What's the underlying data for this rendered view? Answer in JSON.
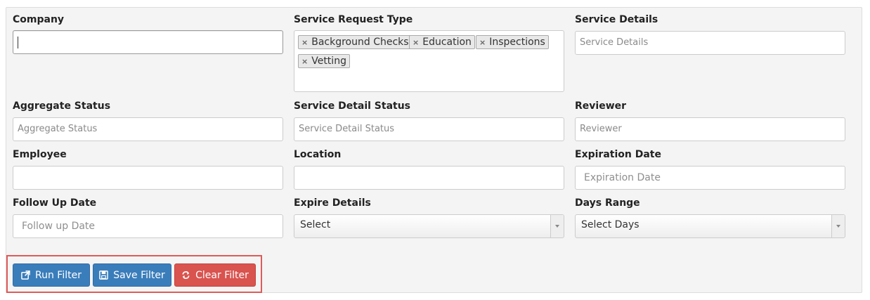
{
  "filters": {
    "company": {
      "label": "Company",
      "value": ""
    },
    "service_request_type": {
      "label": "Service Request Type",
      "tags": [
        "Background Checks",
        "Education",
        "Inspections",
        "Vetting"
      ],
      "remove_glyph": "×"
    },
    "service_details": {
      "label": "Service Details",
      "placeholder": "Service Details"
    },
    "aggregate_status": {
      "label": "Aggregate Status",
      "placeholder": "Aggregate Status"
    },
    "service_detail_status": {
      "label": "Service Detail Status",
      "placeholder": "Service Detail Status"
    },
    "reviewer": {
      "label": "Reviewer",
      "placeholder": "Reviewer"
    },
    "employee": {
      "label": "Employee",
      "value": ""
    },
    "location": {
      "label": "Location",
      "value": ""
    },
    "expiration_date": {
      "label": "Expiration Date",
      "placeholder": "Expiration Date"
    },
    "follow_up_date": {
      "label": "Follow Up Date",
      "placeholder": "Follow up Date"
    },
    "expire_details": {
      "label": "Expire Details",
      "selected": "Select"
    },
    "days_range": {
      "label": "Days Range",
      "selected": "Select Days"
    }
  },
  "actions": {
    "run_filter": "Run Filter",
    "save_filter": "Save Filter",
    "clear_filter": "Clear Filter"
  },
  "icons": {
    "run": "external-link-icon",
    "save": "floppy-disk-icon",
    "clear": "refresh-icon",
    "dropdown": "caret-down-icon",
    "tag_remove": "close-icon"
  },
  "colors": {
    "panel_bg": "#f4f4f4",
    "primary": "#3a7dbb",
    "danger": "#d9534f",
    "highlight": "#e05a5a"
  }
}
